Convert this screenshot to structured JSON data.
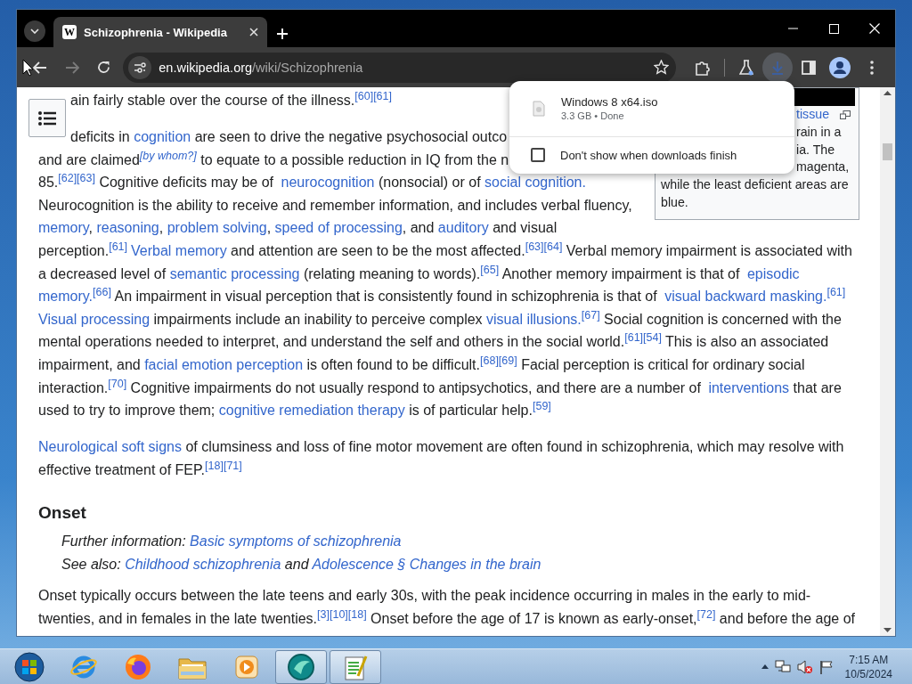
{
  "browser": {
    "tabs": [
      {
        "favicon_letter": "W",
        "title": "Schizophrenia - Wikipedia",
        "selected": true
      }
    ],
    "toolbar": {
      "forward_disabled": true,
      "url_domain": "en.wikipedia.org",
      "url_path": "/wiki/Schizophrenia",
      "downloads_active": true
    }
  },
  "download_popup": {
    "file_name": "Windows 8 x64.iso",
    "file_status": "3.3 GB • Done",
    "option": {
      "label": "Don't show when downloads finish",
      "checked": false
    }
  },
  "infobox": {
    "caption_lines": [
      {
        "kind": "partial",
        "text": "tissue",
        "link": true
      },
      {
        "kind": "partial",
        "text": "rain in a",
        "link": false
      },
      {
        "kind": "partial",
        "text": "ia. The",
        "link": false
      },
      {
        "kind": "partial",
        "text": "magenta,",
        "link": false
      },
      {
        "kind": "whole",
        "text": "while the least deficient areas are",
        "link": false
      },
      {
        "kind": "whole",
        "text": "blue.",
        "link": false
      }
    ]
  },
  "article": {
    "blocks": [
      {
        "kind": "paragraph",
        "lines": [
          [
            {
              "kind": "text",
              "text": "ain fairly stable over the course of the illness."
            },
            {
              "kind": "cite",
              "text": "[60][61]"
            }
          ]
        ]
      },
      {
        "kind": "paragraph",
        "lines": [
          [
            {
              "kind": "text",
              "text": "deficits in "
            },
            {
              "kind": "link",
              "text": "cognition"
            },
            {
              "kind": "text",
              "text": " are seen to drive the negative psychosocial outco"
            }
          ],
          [
            {
              "kind": "text",
              "text": "and are claimed"
            },
            {
              "kind": "note",
              "text": "[by whom?]"
            },
            {
              "kind": "text",
              "text": " to equate to a possible reduction in IQ from the n"
            }
          ],
          [
            {
              "kind": "text",
              "text": "85."
            },
            {
              "kind": "cite",
              "text": "[62][63]"
            },
            {
              "kind": "text",
              "text": " Cognitive deficits may be of "
            },
            {
              "kind": "link",
              "text": "neurocognition"
            },
            {
              "kind": "text",
              "text": " (nonsocial) or of "
            },
            {
              "kind": "link",
              "text": "social cognition."
            }
          ],
          [
            {
              "kind": "text",
              "text": "Neurocognition is the ability to receive and remember information, and includes verbal fluency,"
            }
          ],
          [
            {
              "kind": "link",
              "text": "memory"
            },
            {
              "kind": "text",
              "text": ", "
            },
            {
              "kind": "link",
              "text": "reasoning"
            },
            {
              "kind": "text",
              "text": ", "
            },
            {
              "kind": "link",
              "text": "problem solving"
            },
            {
              "kind": "text",
              "text": ", "
            },
            {
              "kind": "link",
              "text": "speed of processing"
            },
            {
              "kind": "text",
              "text": ", and "
            },
            {
              "kind": "link",
              "text": "auditory"
            },
            {
              "kind": "text",
              "text": " and visual"
            }
          ],
          [
            {
              "kind": "text",
              "text": "perception."
            },
            {
              "kind": "cite",
              "text": "[61]"
            },
            {
              "kind": "link",
              "text": "Verbal memory"
            },
            {
              "kind": "text",
              "text": " and attention are seen to be the most affected."
            },
            {
              "kind": "cite",
              "text": "[63][64]"
            },
            {
              "kind": "text",
              "text": " Verbal memory impairment is associated with"
            }
          ],
          [
            {
              "kind": "text",
              "text": "a decreased level of "
            },
            {
              "kind": "link",
              "text": "semantic processing"
            },
            {
              "kind": "text",
              "text": " (relating meaning to words)."
            },
            {
              "kind": "cite",
              "text": "[65]"
            },
            {
              "kind": "text",
              "text": " Another memory impairment is that of "
            },
            {
              "kind": "link",
              "text": "episodic"
            }
          ],
          [
            {
              "kind": "link",
              "text": "memory."
            },
            {
              "kind": "cite",
              "text": "[66]"
            },
            {
              "kind": "text",
              "text": " An impairment in visual perception that is consistently found in schizophrenia is that of "
            },
            {
              "kind": "link",
              "text": "visual backward masking."
            },
            {
              "kind": "cite",
              "text": "[61]"
            }
          ],
          [
            {
              "kind": "link",
              "text": "Visual processing"
            },
            {
              "kind": "text",
              "text": " impairments include an inability to perceive complex "
            },
            {
              "kind": "link",
              "text": "visual illusions."
            },
            {
              "kind": "cite",
              "text": "[67]"
            },
            {
              "kind": "text",
              "text": " Social cognition is concerned with the"
            }
          ],
          [
            {
              "kind": "text",
              "text": "mental operations needed to interpret, and understand the self and others in the social world."
            },
            {
              "kind": "cite",
              "text": "[61][54]"
            },
            {
              "kind": "text",
              "text": " This is also an associated"
            }
          ],
          [
            {
              "kind": "text",
              "text": "impairment, and "
            },
            {
              "kind": "link",
              "text": "facial emotion perception"
            },
            {
              "kind": "text",
              "text": " is often found to be difficult."
            },
            {
              "kind": "cite",
              "text": "[68][69]"
            },
            {
              "kind": "text",
              "text": " Facial perception is critical for ordinary social"
            }
          ],
          [
            {
              "kind": "text",
              "text": "interaction."
            },
            {
              "kind": "cite",
              "text": "[70]"
            },
            {
              "kind": "text",
              "text": " Cognitive impairments do not usually respond to antipsychotics, and there are a number of "
            },
            {
              "kind": "link",
              "text": "interventions"
            },
            {
              "kind": "text",
              "text": " that are"
            }
          ],
          [
            {
              "kind": "text",
              "text": "used to try to improve them; "
            },
            {
              "kind": "link",
              "text": "cognitive remediation therapy"
            },
            {
              "kind": "text",
              "text": " is of particular help."
            },
            {
              "kind": "cite",
              "text": "[59]"
            }
          ]
        ]
      },
      {
        "kind": "paragraph",
        "lines": [
          [
            {
              "kind": "link",
              "text": "Neurological soft signs"
            },
            {
              "kind": "text",
              "text": " of clumsiness and loss of fine motor movement are often found in schizophrenia, which may resolve with"
            }
          ],
          [
            {
              "kind": "text",
              "text": "effective treatment of FEP."
            },
            {
              "kind": "cite",
              "text": "[18][71]"
            }
          ]
        ]
      },
      {
        "kind": "heading",
        "text": "Onset"
      },
      {
        "kind": "hatnote",
        "lines": [
          [
            {
              "kind": "text",
              "text": "Further information: "
            },
            {
              "kind": "link",
              "text": "Basic symptoms of schizophrenia"
            }
          ],
          [
            {
              "kind": "text",
              "text": "See also: "
            },
            {
              "kind": "link",
              "text": "Childhood schizophrenia"
            },
            {
              "kind": "text",
              "text": " and "
            },
            {
              "kind": "link",
              "text": "Adolescence § Changes in the brain"
            }
          ]
        ]
      },
      {
        "kind": "paragraph",
        "lines": [
          [
            {
              "kind": "text",
              "text": "Onset typically occurs between the late teens and early 30s, with the peak incidence occurring in males in the early to mid-"
            }
          ],
          [
            {
              "kind": "text",
              "text": "twenties, and in females in the late twenties."
            },
            {
              "kind": "cite",
              "text": "[3][10][18]"
            },
            {
              "kind": "text",
              "text": " Onset before the age of 17 is known as early-onset,"
            },
            {
              "kind": "cite",
              "text": "[72]"
            },
            {
              "kind": "text",
              "text": " and before the age of"
            }
          ]
        ]
      }
    ]
  },
  "taskbar": {
    "apps": [
      {
        "kind": "start",
        "active": false
      },
      {
        "kind": "browser-e",
        "active": false
      },
      {
        "kind": "fox",
        "active": false
      },
      {
        "kind": "folder",
        "active": false
      },
      {
        "kind": "media",
        "active": false
      },
      {
        "kind": "orb",
        "active": true
      },
      {
        "kind": "notepad",
        "active": true
      }
    ],
    "time": "7:15 AM",
    "date": "10/5/2024"
  }
}
